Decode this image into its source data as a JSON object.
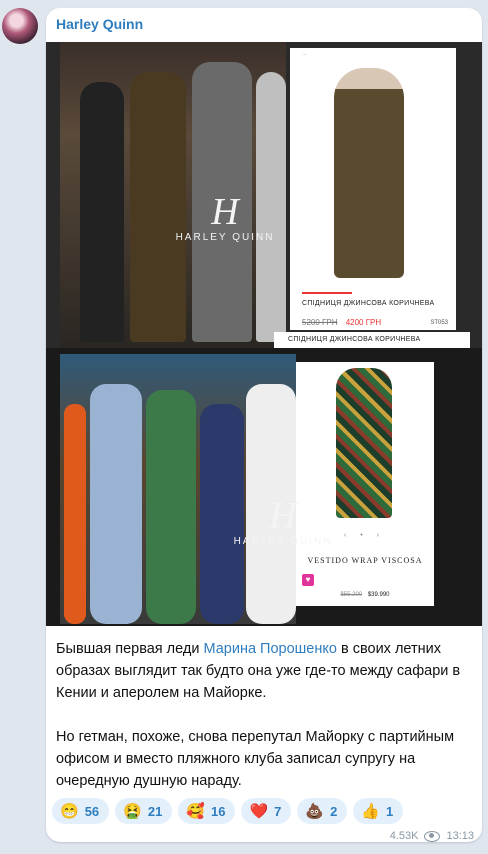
{
  "channel": {
    "sender_name": "Harley Quinn"
  },
  "photos": {
    "watermark_text": "HARLEY QUINN",
    "product1": {
      "title": "СПІДНИЦЯ ДЖИНСОВА КОРИЧНЕВА",
      "old_price": "5200 ГРН",
      "new_price": "4200 ГРН",
      "sku": "ST053"
    },
    "product1_strip_title": "СПІДНИЦЯ ДЖИНСОВА КОРИЧНЕВА",
    "product2": {
      "name": "VESTIDO WRAP VISCOSA",
      "old_price": "$55.200",
      "new_price": "$39.990"
    }
  },
  "caption": {
    "part1_before": "Бывшая первая леди ",
    "part1_link": "Марина Порошенко",
    "part1_after": " в своих летних образах выглядит так будто она уже где-то между сафари в Кении и аперолем на Майорке.",
    "part2": "Но гетман, похоже, снова перепутал Майорку с партийным офисом и вместо пляжного клуба записал супругу на очередную душную нараду."
  },
  "reactions": [
    {
      "emoji": "😁",
      "count": "56"
    },
    {
      "emoji": "🤮",
      "count": "21"
    },
    {
      "emoji": "🥰",
      "count": "16"
    },
    {
      "emoji": "❤️",
      "count": "7"
    },
    {
      "emoji": "💩",
      "count": "2"
    },
    {
      "emoji": "👍",
      "count": "1"
    }
  ],
  "meta": {
    "views": "4.53K",
    "time": "13:13"
  },
  "colors": {
    "background": "#dfe6ee",
    "accent": "#2e7dbf",
    "reaction_bg": "#e3f0fb"
  }
}
